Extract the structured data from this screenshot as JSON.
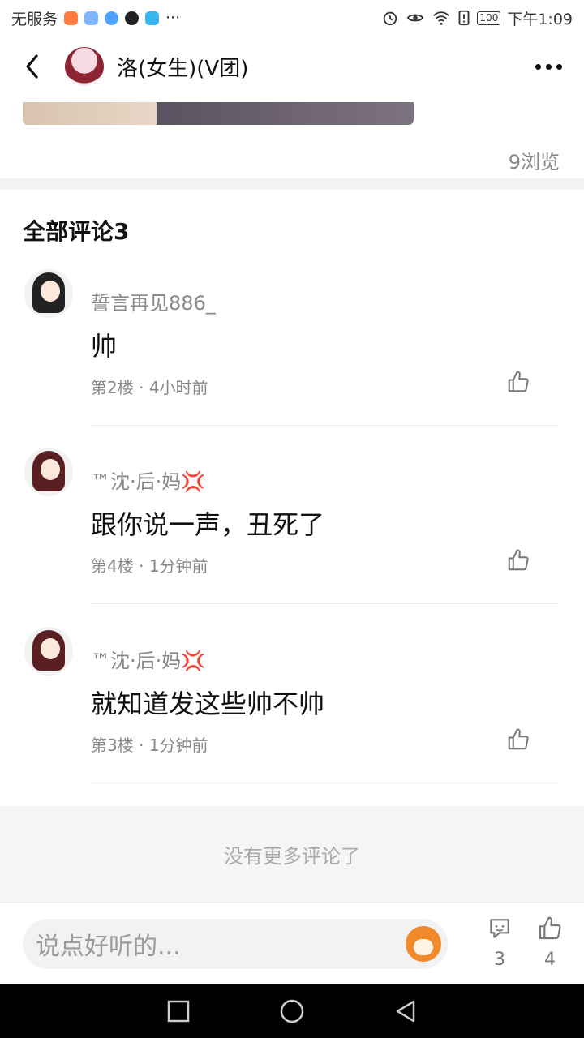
{
  "status_bar": {
    "carrier": "无服务",
    "more": "···",
    "battery": "100",
    "time": "下午1:09"
  },
  "header": {
    "title": "洛(女生)(V团)"
  },
  "post": {
    "views": "9浏览"
  },
  "comments_section": {
    "title": "全部评论3",
    "items": [
      {
        "name": "誓言再见886_",
        "text": "帅",
        "floor": "第2楼",
        "time": "4小时前"
      },
      {
        "name": "™沈·后·妈💢",
        "text": "跟你说一声，丑死了",
        "floor": "第4楼",
        "time": "1分钟前"
      },
      {
        "name": "™沈·后·妈💢",
        "text": "就知道发这些帅不帅",
        "floor": "第3楼",
        "time": "1分钟前"
      }
    ],
    "no_more": "没有更多评论了"
  },
  "bottom_bar": {
    "input_placeholder": "说点好听的...",
    "comment_count": "3",
    "like_count": "4"
  },
  "colors": {
    "accent_gray": "#888888",
    "emoji_orange": "#f08a2c"
  }
}
